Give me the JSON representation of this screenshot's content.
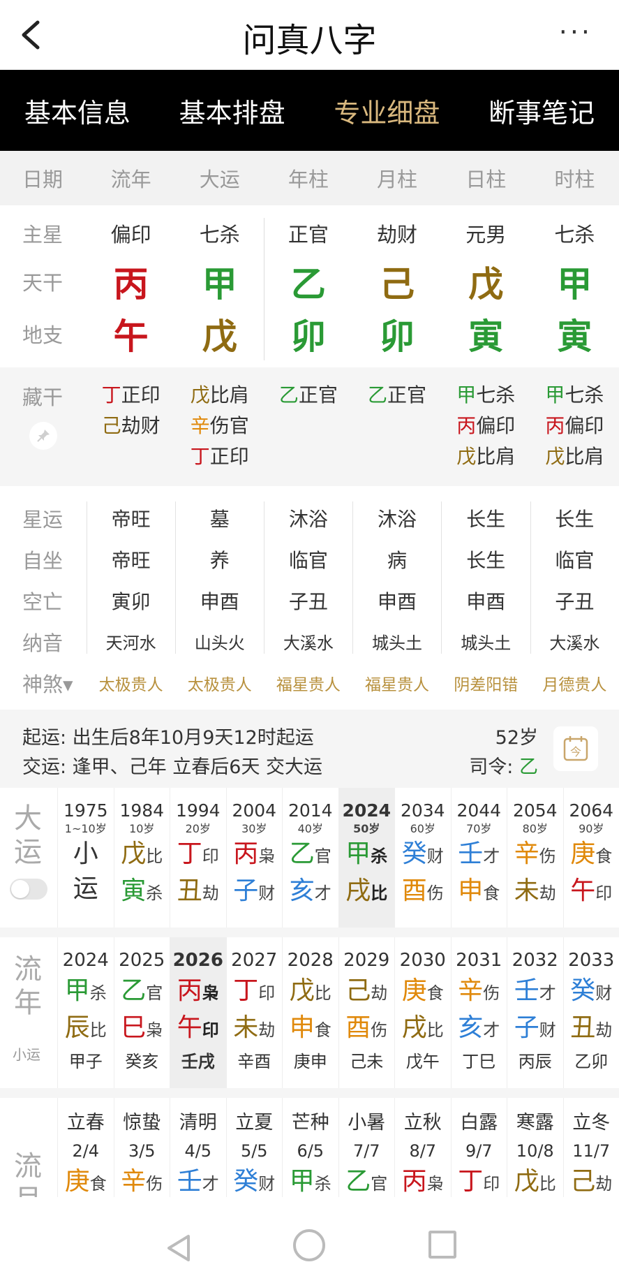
{
  "header": {
    "title": "问真八字",
    "more": "···"
  },
  "tabs": [
    "基本信息",
    "基本排盘",
    "专业细盘",
    "断事笔记"
  ],
  "active_tab": 2,
  "columns": {
    "label": "日期",
    "items": [
      "流年",
      "大运",
      "年柱",
      "月柱",
      "日柱",
      "时柱"
    ]
  },
  "main": {
    "star_label": "主星",
    "stars": [
      "偏印",
      "七杀",
      "正官",
      "劫财",
      "元男",
      "七杀"
    ],
    "stem_label": "天干",
    "stems": [
      "丙",
      "甲",
      "乙",
      "己",
      "戊",
      "甲"
    ],
    "branch_label": "地支",
    "branches": [
      "午",
      "戊",
      "卯",
      "卯",
      "寅",
      "寅"
    ]
  },
  "hidden": {
    "label": "藏干",
    "cols": [
      [
        {
          "g": "丁",
          "t": "正印",
          "c": "red"
        },
        {
          "g": "己",
          "t": "劫财",
          "c": "brown"
        }
      ],
      [
        {
          "g": "戊",
          "t": "比肩",
          "c": "brown"
        },
        {
          "g": "辛",
          "t": "伤官",
          "c": "orange"
        },
        {
          "g": "丁",
          "t": "正印",
          "c": "red"
        }
      ],
      [
        {
          "g": "乙",
          "t": "正官",
          "c": "green"
        }
      ],
      [
        {
          "g": "乙",
          "t": "正官",
          "c": "green"
        }
      ],
      [
        {
          "g": "甲",
          "t": "七杀",
          "c": "green"
        },
        {
          "g": "丙",
          "t": "偏印",
          "c": "red"
        },
        {
          "g": "戊",
          "t": "比肩",
          "c": "brown"
        }
      ],
      [
        {
          "g": "甲",
          "t": "七杀",
          "c": "green"
        },
        {
          "g": "丙",
          "t": "偏印",
          "c": "red"
        },
        {
          "g": "戊",
          "t": "比肩",
          "c": "brown"
        }
      ]
    ]
  },
  "fortune": {
    "xingyun_label": "星运",
    "xingyun": [
      "帝旺",
      "墓",
      "沐浴",
      "沐浴",
      "长生",
      "长生"
    ],
    "zizuo_label": "自坐",
    "zizuo": [
      "帝旺",
      "养",
      "临官",
      "病",
      "长生",
      "临官"
    ],
    "kongwang_label": "空亡",
    "kongwang": [
      "寅卯",
      "申酉",
      "子丑",
      "申酉",
      "申酉",
      "子丑"
    ],
    "nayin_label": "纳音",
    "nayin": [
      "天河水",
      "山头火",
      "大溪水",
      "城头土",
      "城头土",
      "大溪水"
    ],
    "shensha_label": "神煞▾",
    "shensha": [
      "太极贵人",
      "太极贵人",
      "福星贵人",
      "福星贵人",
      "阴差阳错",
      "月德贵人"
    ]
  },
  "qiyun": {
    "line1": "起运:  出生后8年10月9天12时起运",
    "line2": "交运:  逢甲、己年 立春后6天 交大运",
    "age": "52岁",
    "siling_label": "司令:",
    "siling": "乙"
  },
  "dayun": {
    "title": "大运",
    "cols": [
      {
        "yr": "1975",
        "age": "1~10岁",
        "xiao": true,
        "a": "小",
        "b": "运"
      },
      {
        "yr": "1984",
        "age": "10岁",
        "a": "戊",
        "ac": "brown",
        "as": "比",
        "b": "寅",
        "bc": "green",
        "bs": "杀"
      },
      {
        "yr": "1994",
        "age": "20岁",
        "a": "丁",
        "ac": "red",
        "as": "印",
        "b": "丑",
        "bc": "brown",
        "bs": "劫"
      },
      {
        "yr": "2004",
        "age": "30岁",
        "a": "丙",
        "ac": "red",
        "as": "枭",
        "b": "子",
        "bc": "blue",
        "bs": "财"
      },
      {
        "yr": "2014",
        "age": "40岁",
        "a": "乙",
        "ac": "green",
        "as": "官",
        "b": "亥",
        "bc": "blue",
        "bs": "才"
      },
      {
        "yr": "2024",
        "age": "50岁",
        "cur": true,
        "a": "甲",
        "ac": "green",
        "as": "杀",
        "b": "戌",
        "bc": "brown",
        "bs": "比"
      },
      {
        "yr": "2034",
        "age": "60岁",
        "a": "癸",
        "ac": "blue",
        "as": "财",
        "b": "酉",
        "bc": "orange",
        "bs": "伤"
      },
      {
        "yr": "2044",
        "age": "70岁",
        "a": "壬",
        "ac": "blue",
        "as": "才",
        "b": "申",
        "bc": "orange",
        "bs": "食"
      },
      {
        "yr": "2054",
        "age": "80岁",
        "a": "辛",
        "ac": "orange",
        "as": "伤",
        "b": "未",
        "bc": "brown",
        "bs": "劫"
      },
      {
        "yr": "2064",
        "age": "90岁",
        "a": "庚",
        "ac": "orange",
        "as": "食",
        "b": "午",
        "bc": "red",
        "bs": "印"
      }
    ]
  },
  "liunian": {
    "title": "流年",
    "sub": "小运",
    "cols": [
      {
        "yr": "2024",
        "a": "甲",
        "ac": "green",
        "as": "杀",
        "b": "辰",
        "bc": "brown",
        "bs": "比",
        "jz": "甲子"
      },
      {
        "yr": "2025",
        "a": "乙",
        "ac": "green",
        "as": "官",
        "b": "巳",
        "bc": "red",
        "bs": "枭",
        "jz": "癸亥"
      },
      {
        "yr": "2026",
        "cur": true,
        "a": "丙",
        "ac": "red",
        "as": "枭",
        "b": "午",
        "bc": "red",
        "bs": "印",
        "jz": "壬戌"
      },
      {
        "yr": "2027",
        "a": "丁",
        "ac": "red",
        "as": "印",
        "b": "未",
        "bc": "brown",
        "bs": "劫",
        "jz": "辛酉"
      },
      {
        "yr": "2028",
        "a": "戊",
        "ac": "brown",
        "as": "比",
        "b": "申",
        "bc": "orange",
        "bs": "食",
        "jz": "庚申"
      },
      {
        "yr": "2029",
        "a": "己",
        "ac": "brown",
        "as": "劫",
        "b": "酉",
        "bc": "orange",
        "bs": "伤",
        "jz": "己未"
      },
      {
        "yr": "2030",
        "a": "庚",
        "ac": "orange",
        "as": "食",
        "b": "戌",
        "bc": "brown",
        "bs": "比",
        "jz": "戊午"
      },
      {
        "yr": "2031",
        "a": "辛",
        "ac": "orange",
        "as": "伤",
        "b": "亥",
        "bc": "blue",
        "bs": "才",
        "jz": "丁巳"
      },
      {
        "yr": "2032",
        "a": "壬",
        "ac": "blue",
        "as": "才",
        "b": "子",
        "bc": "blue",
        "bs": "财",
        "jz": "丙辰"
      },
      {
        "yr": "2033",
        "a": "癸",
        "ac": "blue",
        "as": "财",
        "b": "丑",
        "bc": "brown",
        "bs": "劫",
        "jz": "乙卯"
      }
    ]
  },
  "liuyue": {
    "title": "流月",
    "cols": [
      {
        "term": "立春",
        "date": "2/4",
        "a": "庚",
        "ac": "orange",
        "as": "食"
      },
      {
        "term": "惊蛰",
        "date": "3/5",
        "a": "辛",
        "ac": "orange",
        "as": "伤"
      },
      {
        "term": "清明",
        "date": "4/5",
        "a": "壬",
        "ac": "blue",
        "as": "才"
      },
      {
        "term": "立夏",
        "date": "5/5",
        "a": "癸",
        "ac": "blue",
        "as": "财"
      },
      {
        "term": "芒种",
        "date": "6/5",
        "a": "甲",
        "ac": "green",
        "as": "杀"
      },
      {
        "term": "小暑",
        "date": "7/7",
        "a": "乙",
        "ac": "green",
        "as": "官"
      },
      {
        "term": "立秋",
        "date": "8/7",
        "a": "丙",
        "ac": "red",
        "as": "枭"
      },
      {
        "term": "白露",
        "date": "9/7",
        "a": "丁",
        "ac": "red",
        "as": "印"
      },
      {
        "term": "寒露",
        "date": "10/8",
        "a": "戊",
        "ac": "brown",
        "as": "比"
      },
      {
        "term": "立冬",
        "date": "11/7",
        "a": "己",
        "ac": "brown",
        "as": "劫"
      }
    ]
  },
  "colors": {
    "tab_bg": "#000000",
    "tab_active": "#d9b87e",
    "red": "#c8161d",
    "green": "#2a9a35",
    "brown": "#8f6b12",
    "orange": "#e0890b",
    "blue": "#2e7fd6",
    "shensha": "#b8913e"
  }
}
